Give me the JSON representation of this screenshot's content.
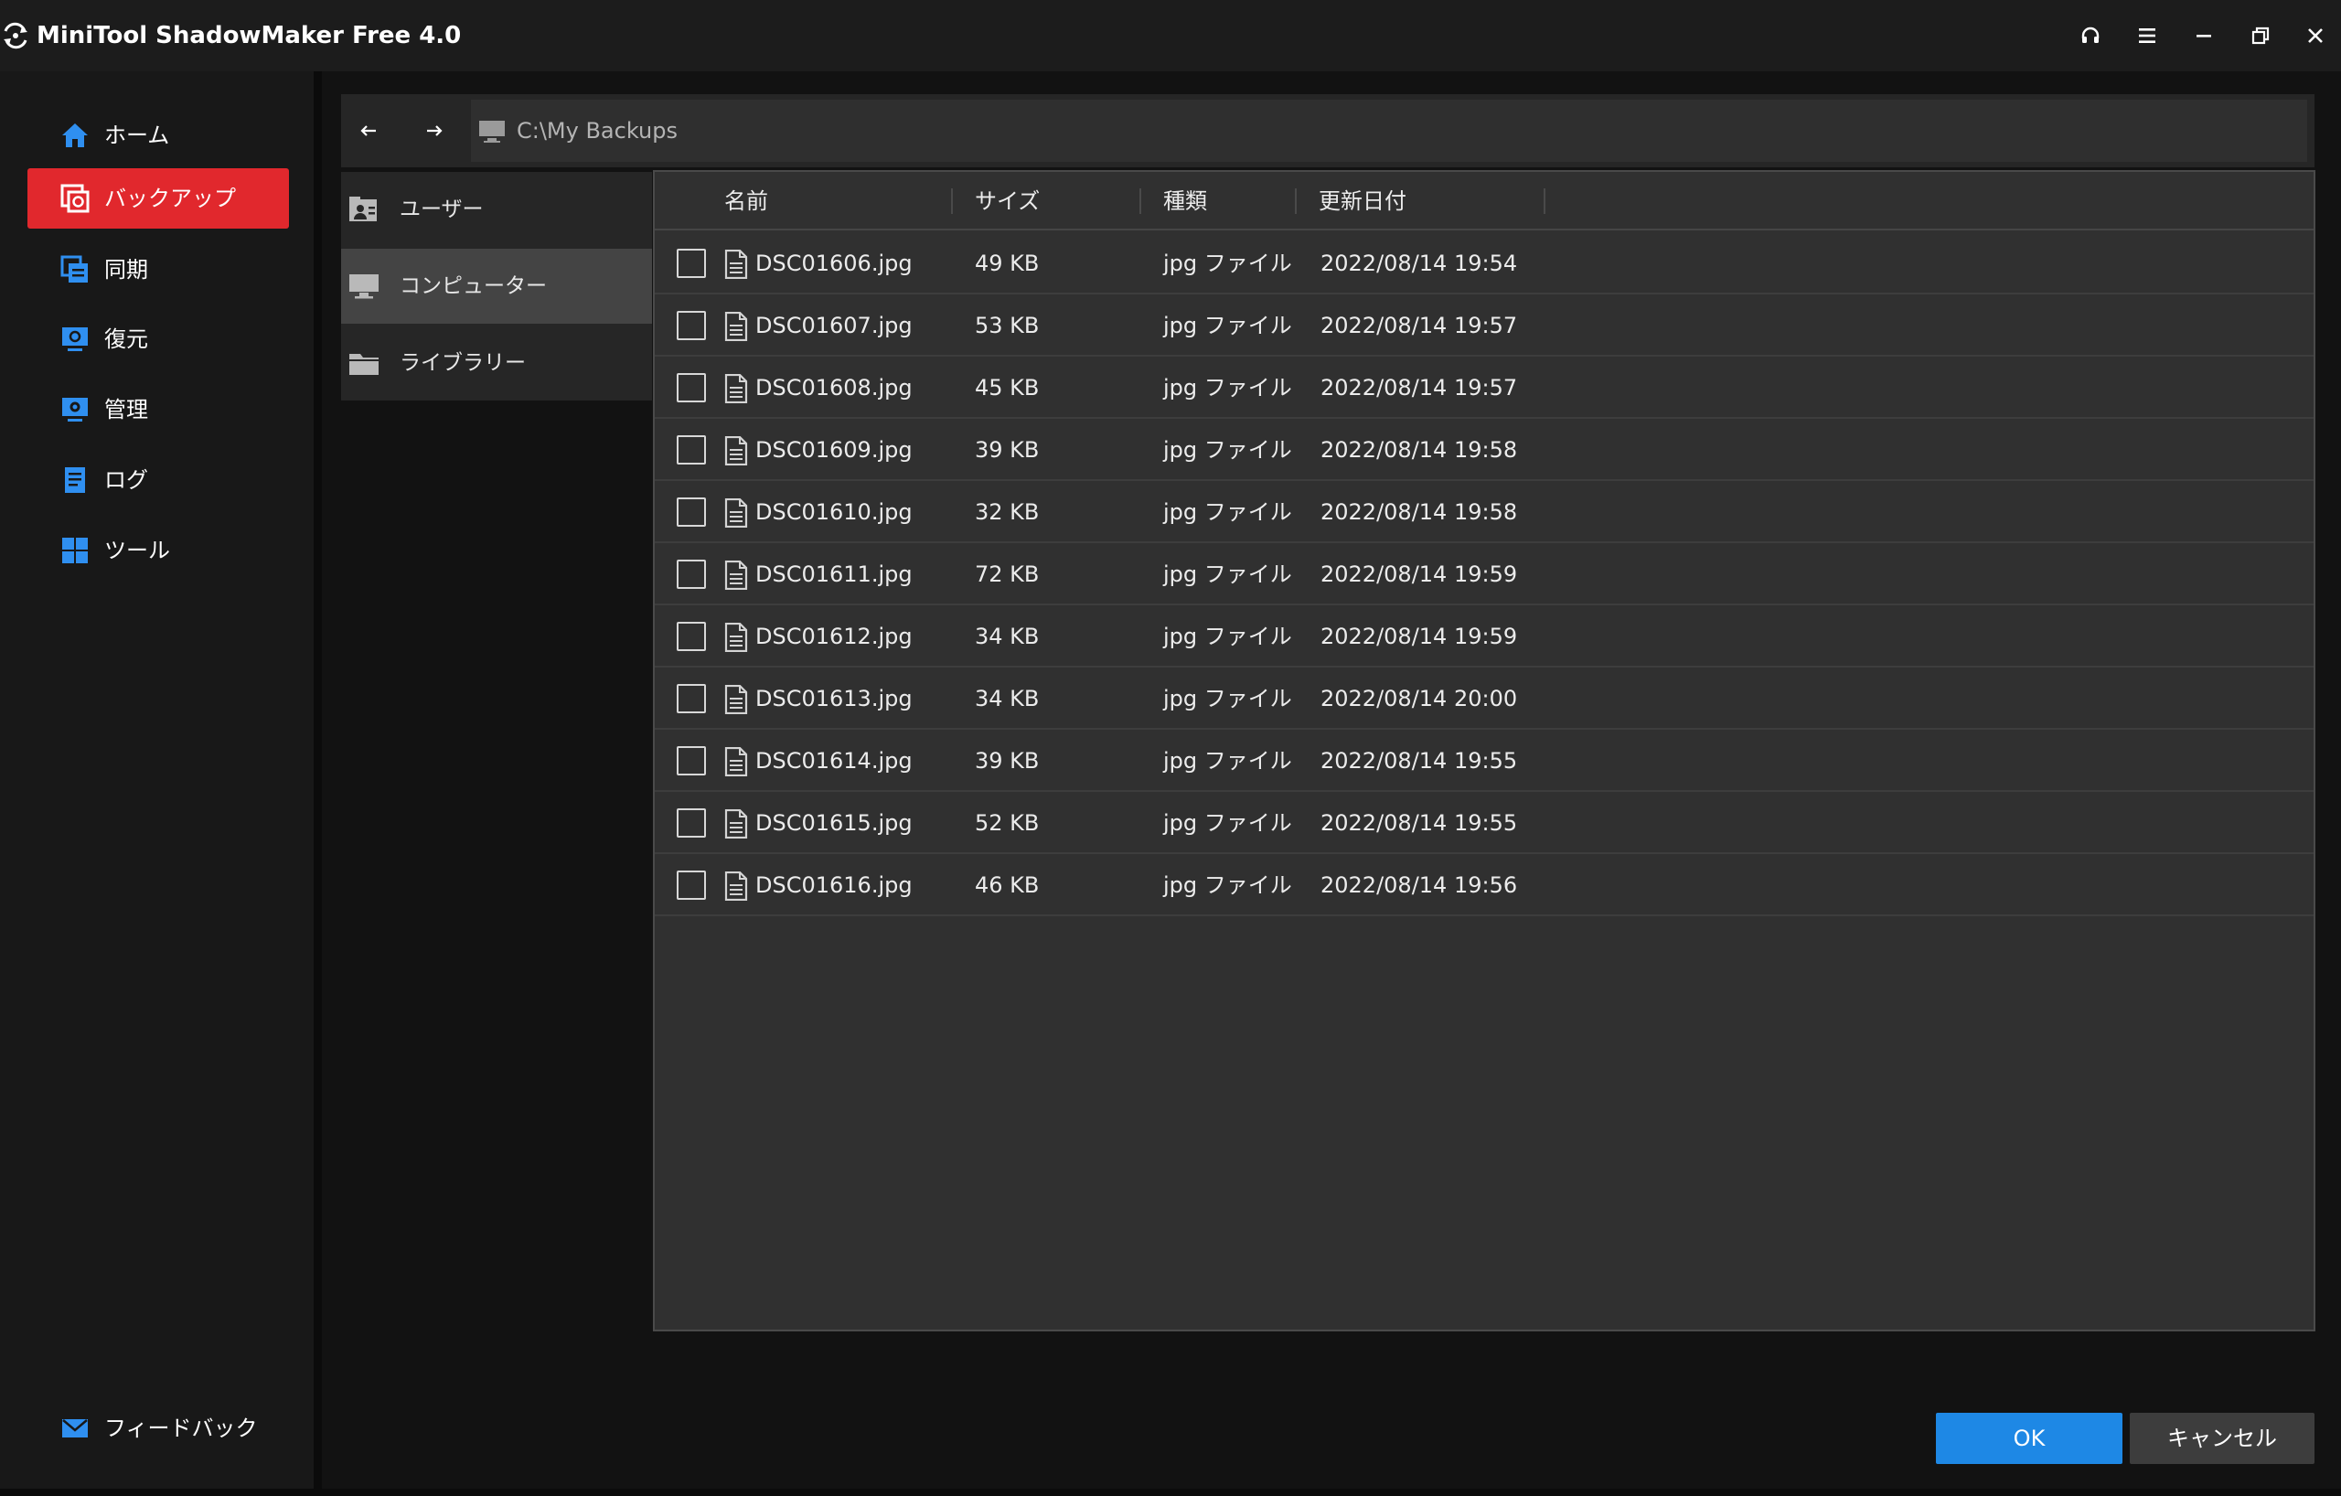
{
  "app": {
    "title": "MiniTool ShadowMaker Free 4.0"
  },
  "window_controls": [
    "headset-icon",
    "menu-icon",
    "minimize-icon",
    "restore-icon",
    "close-icon"
  ],
  "sidebar": {
    "items": [
      {
        "label": "ホーム",
        "icon": "home-icon"
      },
      {
        "label": "バックアップ",
        "icon": "backup-icon",
        "active": true
      },
      {
        "label": "同期",
        "icon": "sync-icon"
      },
      {
        "label": "復元",
        "icon": "restore-icon"
      },
      {
        "label": "管理",
        "icon": "manage-icon"
      },
      {
        "label": "ログ",
        "icon": "log-icon"
      },
      {
        "label": "ツール",
        "icon": "tools-icon"
      }
    ],
    "feedback": {
      "label": "フィードバック",
      "icon": "mail-icon"
    }
  },
  "toolbar": {
    "path": "C:\\My Backups"
  },
  "locations": [
    {
      "label": "ユーザー",
      "icon": "user-icon"
    },
    {
      "label": "コンピューター",
      "icon": "computer-icon",
      "selected": true
    },
    {
      "label": "ライブラリー",
      "icon": "folder-icon"
    }
  ],
  "table": {
    "headers": {
      "name": "名前",
      "size": "サイズ",
      "type": "種類",
      "date": "更新日付"
    },
    "rows": [
      {
        "name": "DSC01606.jpg",
        "size": "49 KB",
        "type": "jpg ファイル",
        "date": "2022/08/14 19:54"
      },
      {
        "name": "DSC01607.jpg",
        "size": "53 KB",
        "type": "jpg ファイル",
        "date": "2022/08/14 19:57"
      },
      {
        "name": "DSC01608.jpg",
        "size": "45 KB",
        "type": "jpg ファイル",
        "date": "2022/08/14 19:57"
      },
      {
        "name": "DSC01609.jpg",
        "size": "39 KB",
        "type": "jpg ファイル",
        "date": "2022/08/14 19:58"
      },
      {
        "name": "DSC01610.jpg",
        "size": "32 KB",
        "type": "jpg ファイル",
        "date": "2022/08/14 19:58"
      },
      {
        "name": "DSC01611.jpg",
        "size": "72 KB",
        "type": "jpg ファイル",
        "date": "2022/08/14 19:59"
      },
      {
        "name": "DSC01612.jpg",
        "size": "34 KB",
        "type": "jpg ファイル",
        "date": "2022/08/14 19:59"
      },
      {
        "name": "DSC01613.jpg",
        "size": "34 KB",
        "type": "jpg ファイル",
        "date": "2022/08/14 20:00"
      },
      {
        "name": "DSC01614.jpg",
        "size": "39 KB",
        "type": "jpg ファイル",
        "date": "2022/08/14 19:55"
      },
      {
        "name": "DSC01615.jpg",
        "size": "52 KB",
        "type": "jpg ファイル",
        "date": "2022/08/14 19:55"
      },
      {
        "name": "DSC01616.jpg",
        "size": "46 KB",
        "type": "jpg ファイル",
        "date": "2022/08/14 19:56"
      }
    ]
  },
  "buttons": {
    "ok": "OK",
    "cancel": "キャンセル"
  },
  "colors": {
    "accent_red": "#e1282d",
    "accent_blue": "#1e88e5",
    "icon_blue": "#2f8ff0"
  }
}
